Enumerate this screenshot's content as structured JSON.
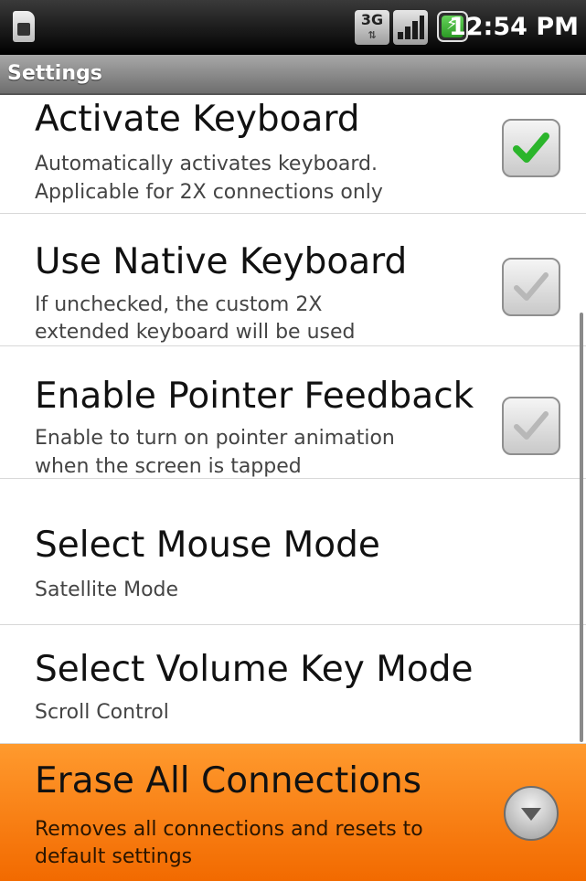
{
  "status_bar": {
    "clock": "12:54 PM",
    "network_label": "3G",
    "icons": [
      "sim-card-icon",
      "network-3g-icon",
      "signal-strength-icon",
      "battery-charging-icon"
    ]
  },
  "title_bar": {
    "title": "Settings"
  },
  "settings": [
    {
      "title": "Activate Keyboard",
      "summary_line1": "Automatically activates keyboard.",
      "summary_line2": "Applicable for 2X connections only",
      "control": "checkbox",
      "checked": true
    },
    {
      "title": "Use Native Keyboard",
      "summary_line1": "If unchecked, the custom 2X",
      "summary_line2": "extended keyboard will be used",
      "control": "checkbox",
      "checked": false
    },
    {
      "title": "Enable Pointer Feedback",
      "summary_line1": "Enable to turn on pointer animation",
      "summary_line2": "when the screen is tapped",
      "control": "checkbox",
      "checked": false
    },
    {
      "title": "Select Mouse Mode",
      "summary_line1": "Satellite Mode",
      "control": "none"
    },
    {
      "title": "Select Volume Key Mode",
      "summary_line1": "Scroll Control",
      "control": "none"
    },
    {
      "title": "Erase All Connections",
      "summary_line1": "Removes all connections and resets to",
      "summary_line2": "default settings",
      "control": "dropdown",
      "highlighted": true
    }
  ],
  "colors": {
    "highlight": "#f58400",
    "check_green": "#2bb52b",
    "title_bar": "#8a8a8a"
  }
}
